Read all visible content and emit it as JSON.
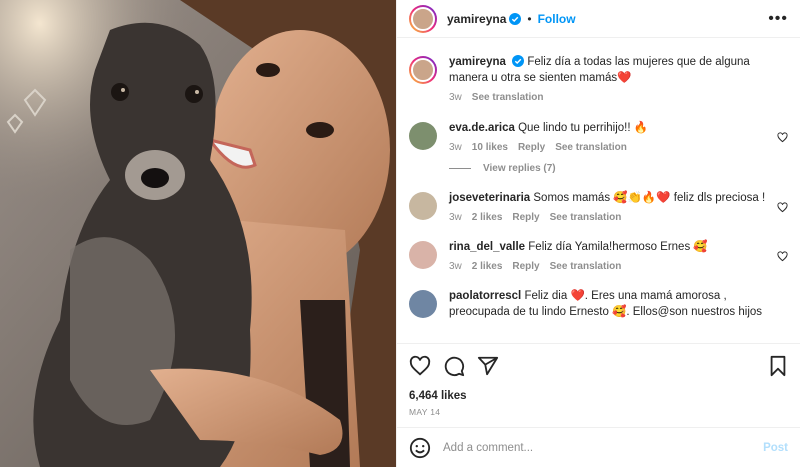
{
  "post": {
    "username": "yamireyna",
    "follow_label": "Follow",
    "separator": "•",
    "more_label": "•••",
    "caption": "Feliz día a todas las mujeres que de alguna manera u otra se sienten mamás❤️",
    "caption_time": "3w",
    "see_translation": "See translation"
  },
  "comments": [
    {
      "user": "eva.de.arica",
      "text": "Que lindo tu perrihijo!! 🔥",
      "time": "3w",
      "likes": "10 likes",
      "reply": "Reply",
      "translate": "See translation",
      "avatar_color": "#7d8f6e"
    },
    {
      "user": "joseveterinaria",
      "text": "Somos mamás 🥰👏🔥❤️ feliz dls preciosa !",
      "time": "3w",
      "likes": "2 likes",
      "reply": "Reply",
      "translate": "See translation",
      "avatar_color": "#c7b7a0"
    },
    {
      "user": "rina_del_valle",
      "text": "Feliz día Yamila!hermoso Ernes 🥰",
      "time": "3w",
      "likes": "2 likes",
      "reply": "Reply",
      "translate": "See translation",
      "avatar_color": "#d9b3a8"
    },
    {
      "user": "paolatorrescl",
      "text": "Feliz dia ❤️. Eres una mamá amorosa , preocupada de tu lindo Ernesto 🥰. Ellos@son nuestros hijos",
      "time": "",
      "likes": "",
      "reply": "",
      "translate": "",
      "avatar_color": "#6f86a3"
    }
  ],
  "view_replies": "View replies (7)",
  "likes_count": "6,464 likes",
  "date": "MAY 14",
  "add_comment": {
    "placeholder": "Add a comment...",
    "post_label": "Post"
  },
  "colors": {
    "accent": "#0095f6",
    "muted": "#8e8e8e",
    "text": "#262626"
  }
}
